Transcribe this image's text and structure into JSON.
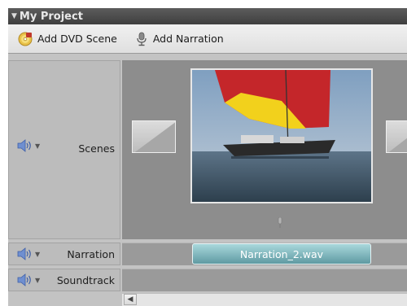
{
  "panel": {
    "title": "My Project"
  },
  "toolbar": {
    "add_dvd_scene_label": "Add DVD Scene",
    "add_narration_label": "Add Narration"
  },
  "tracks": [
    {
      "name": "Scenes",
      "icon": "speaker-icon"
    },
    {
      "name": "Narration",
      "icon": "speaker-icon"
    },
    {
      "name": "Soundtrack",
      "icon": "speaker-icon"
    }
  ],
  "narration_clip": {
    "label": "Narration_2.wav"
  },
  "colors": {
    "clip_teal": "#6ea9b0",
    "header_gray": "#4a4a4a",
    "track_gray": "#8d8d8d"
  }
}
